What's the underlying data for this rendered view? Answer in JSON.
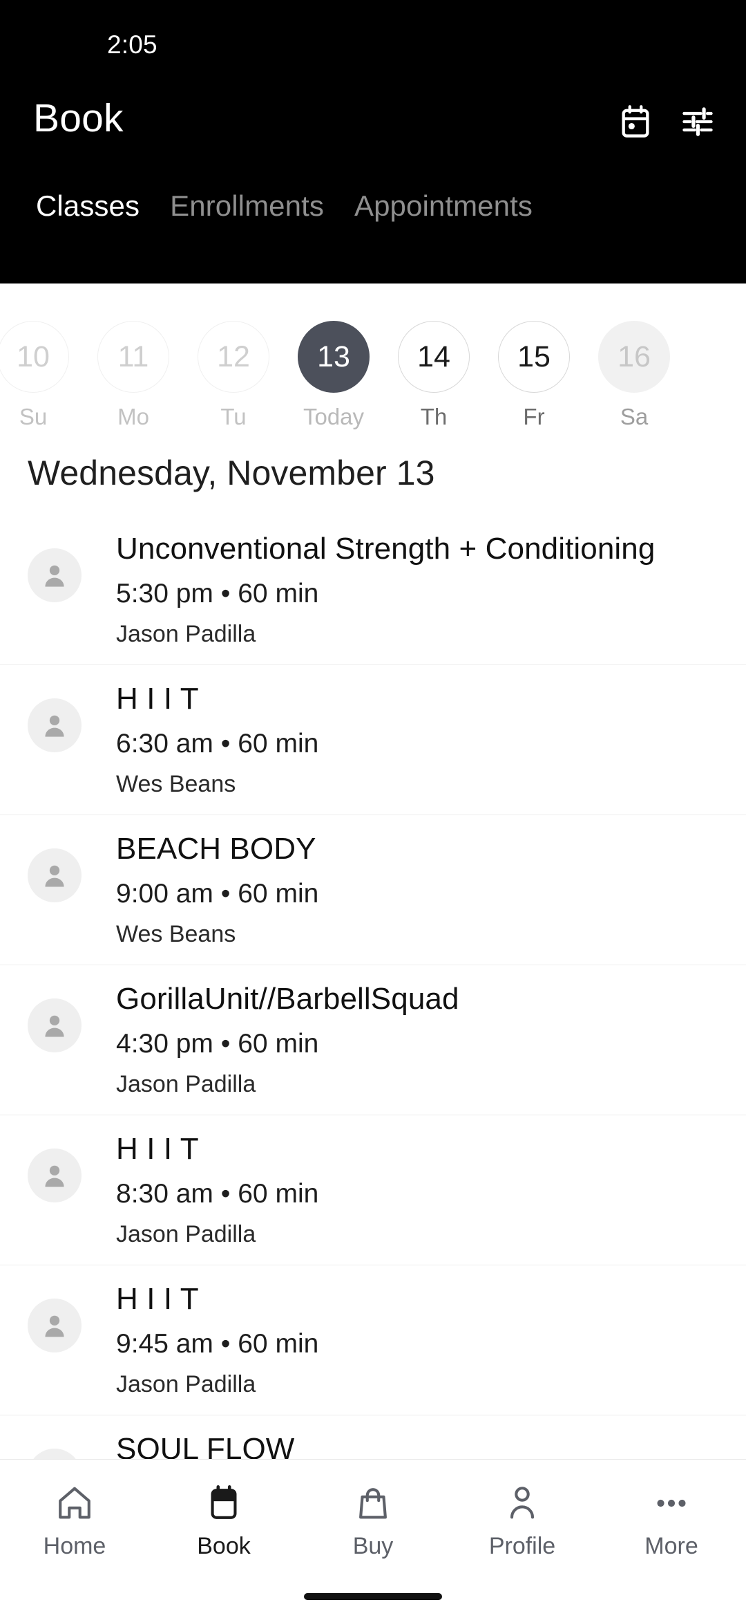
{
  "status_bar": {
    "time": "2:05"
  },
  "app_bar": {
    "title": "Book",
    "actions": [
      {
        "name": "calendar-picker-icon",
        "label": "Calendar"
      },
      {
        "name": "filter-icon",
        "label": "Filters"
      }
    ]
  },
  "tabs": [
    {
      "label": "Classes",
      "active": true
    },
    {
      "label": "Enrollments",
      "active": false
    },
    {
      "label": "Appointments",
      "active": false
    }
  ],
  "date_strip": [
    {
      "day_number": "10",
      "weekday": "Su",
      "state": "past"
    },
    {
      "day_number": "11",
      "weekday": "Mo",
      "state": "past"
    },
    {
      "day_number": "12",
      "weekday": "Tu",
      "state": "past"
    },
    {
      "day_number": "13",
      "weekday": "Today",
      "state": "selected"
    },
    {
      "day_number": "14",
      "weekday": "Th",
      "state": "future"
    },
    {
      "day_number": "15",
      "weekday": "Fr",
      "state": "future"
    },
    {
      "day_number": "16",
      "weekday": "Sa",
      "state": "edge"
    }
  ],
  "day_heading": "Wednesday, November 13",
  "classes": [
    {
      "title": "Unconventional Strength + Conditioning",
      "time": "5:30 pm",
      "duration": "60 min",
      "meta": "5:30 pm • 60 min",
      "instructor": "Jason Padilla",
      "letter_spaced": false
    },
    {
      "title": "H I I T",
      "time": "6:30 am",
      "duration": "60 min",
      "meta": "6:30 am • 60 min",
      "instructor": "Wes Beans",
      "letter_spaced": false
    },
    {
      "title": "BEACH BODY",
      "time": "9:00 am",
      "duration": "60 min",
      "meta": "9:00 am • 60 min",
      "instructor": "Wes Beans",
      "letter_spaced": false
    },
    {
      "title": "GorillaUnit//BarbellSquad",
      "time": "4:30 pm",
      "duration": "60 min",
      "meta": "4:30 pm • 60 min",
      "instructor": "Jason Padilla",
      "letter_spaced": false
    },
    {
      "title": "H I I T",
      "time": "8:30 am",
      "duration": "60 min",
      "meta": "8:30 am • 60 min",
      "instructor": "Jason Padilla",
      "letter_spaced": false
    },
    {
      "title": "H I I T",
      "time": "9:45 am",
      "duration": "60 min",
      "meta": "9:45 am • 60 min",
      "instructor": "Jason Padilla",
      "letter_spaced": false
    },
    {
      "title": "SOUL FLOW",
      "time": "",
      "duration": "",
      "meta": "",
      "instructor": "",
      "letter_spaced": false
    }
  ],
  "bottom_nav": [
    {
      "label": "Home",
      "icon": "home-icon",
      "active": false
    },
    {
      "label": "Book",
      "icon": "calendar-icon",
      "active": true
    },
    {
      "label": "Buy",
      "icon": "shopping-bag-icon",
      "active": false
    },
    {
      "label": "Profile",
      "icon": "person-icon",
      "active": false
    },
    {
      "label": "More",
      "icon": "more-dots-icon",
      "active": false
    }
  ],
  "colors": {
    "header_background": "#000000",
    "selected_date": "#4c505b",
    "page_background": "#ffffff",
    "divider": "#ededed",
    "muted_text": "#8f8f8f"
  }
}
